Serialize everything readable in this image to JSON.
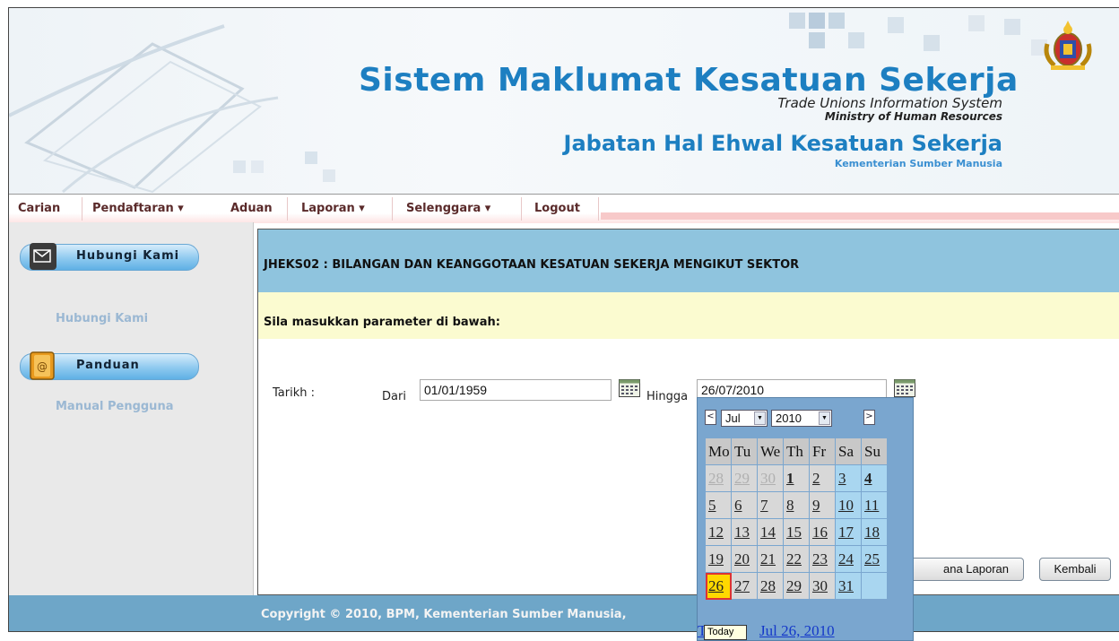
{
  "header": {
    "title": "Sistem Maklumat Kesatuan Sekerja",
    "subtitle_en": "Trade Unions Information System",
    "ministry_en": "Ministry of Human Resources",
    "department": "Jabatan Hal Ehwal Kesatuan Sekerja",
    "ministry_ms": "Kementerian Sumber Manusia"
  },
  "nav": {
    "items": [
      "Carian",
      "Pendaftaran ▾",
      "Aduan",
      "Laporan ▾",
      "Selenggara ▾",
      "Logout"
    ]
  },
  "sidebar": {
    "contact_button": "Hubungi Kami",
    "contact_link": "Hubungi Kami",
    "guide_button": "Panduan",
    "guide_link": "Manual Pengguna"
  },
  "main": {
    "report_title": "JHEKS02 : BILANGAN DAN KEANGGOTAAN KESATUAN SEKERJA MENGIKUT SEKTOR",
    "param_prompt": "Sila masukkan parameter di bawah:",
    "date_label": "Tarikh :",
    "from_label": "Dari",
    "from_value": "01/01/1959",
    "to_label": "Hingga",
    "to_value": "26/07/2010",
    "generate_button": "ana Laporan",
    "back_button": "Kembali"
  },
  "footer": {
    "text": "Copyright © 2010, BPM, Kementerian Sumber Manusia,"
  },
  "calendar": {
    "prev": "<",
    "next": ">",
    "month": "Jul",
    "year": "2010",
    "weekdays": [
      "Mo",
      "Tu",
      "We",
      "Th",
      "Fr",
      "Sa",
      "Su"
    ],
    "weeks": [
      [
        "28",
        "29",
        "30",
        "1",
        "2",
        "3",
        "4"
      ],
      [
        "5",
        "6",
        "7",
        "8",
        "9",
        "10",
        "11"
      ],
      [
        "12",
        "13",
        "14",
        "15",
        "16",
        "17",
        "18"
      ],
      [
        "19",
        "20",
        "21",
        "22",
        "23",
        "24",
        "25"
      ],
      [
        "26",
        "27",
        "28",
        "29",
        "30",
        "31",
        ""
      ]
    ],
    "today_prefix": "T",
    "today_date": "Jul 26, 2010",
    "tooltip": "Today"
  },
  "colors": {
    "title_blue": "#1d7fc1",
    "main_bar": "#8fc4de",
    "param_bar": "#fbfbd0",
    "footer": "#6ea6c8",
    "today_highlight": "#ffd800"
  }
}
